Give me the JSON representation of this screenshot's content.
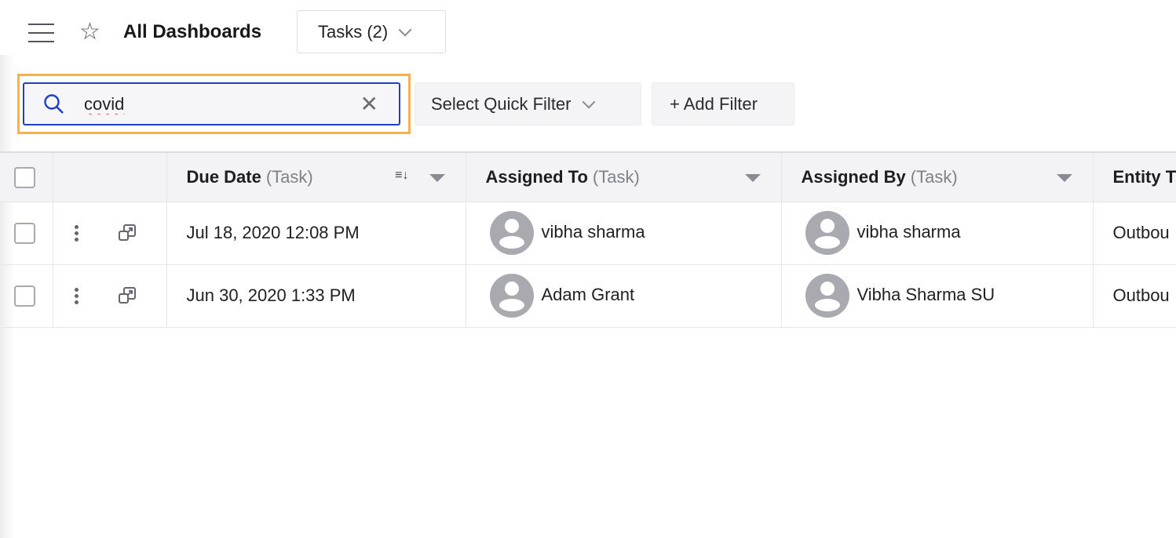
{
  "header": {
    "title": "All Dashboards",
    "tasks_dropdown": "Tasks (2)",
    "menu_icon": "hamburger-icon",
    "star_icon": "star-icon"
  },
  "filters": {
    "search_value": "covid",
    "search_icon": "search-icon",
    "clear_icon": "close-icon",
    "quick_filter": "Select Quick Filter",
    "add_filter": "+ Add Filter"
  },
  "colors": {
    "highlight": "#f5b14c",
    "focus": "#1f3fc6"
  },
  "table": {
    "columns": [
      {
        "label": "Due Date",
        "sub": "(Task)"
      },
      {
        "label": "Assigned To",
        "sub": "(Task)"
      },
      {
        "label": "Assigned By",
        "sub": "(Task)"
      },
      {
        "label": "Entity T",
        "sub": ""
      }
    ],
    "rows": [
      {
        "due": "Jul 18, 2020 12:08 PM",
        "assigned_to": "vibha sharma",
        "assigned_by": "vibha sharma",
        "entity": "Outbou"
      },
      {
        "due": "Jun 30, 2020 1:33 PM",
        "assigned_to": "Adam Grant",
        "assigned_by": "Vibha Sharma SU",
        "entity": "Outbou"
      }
    ]
  }
}
